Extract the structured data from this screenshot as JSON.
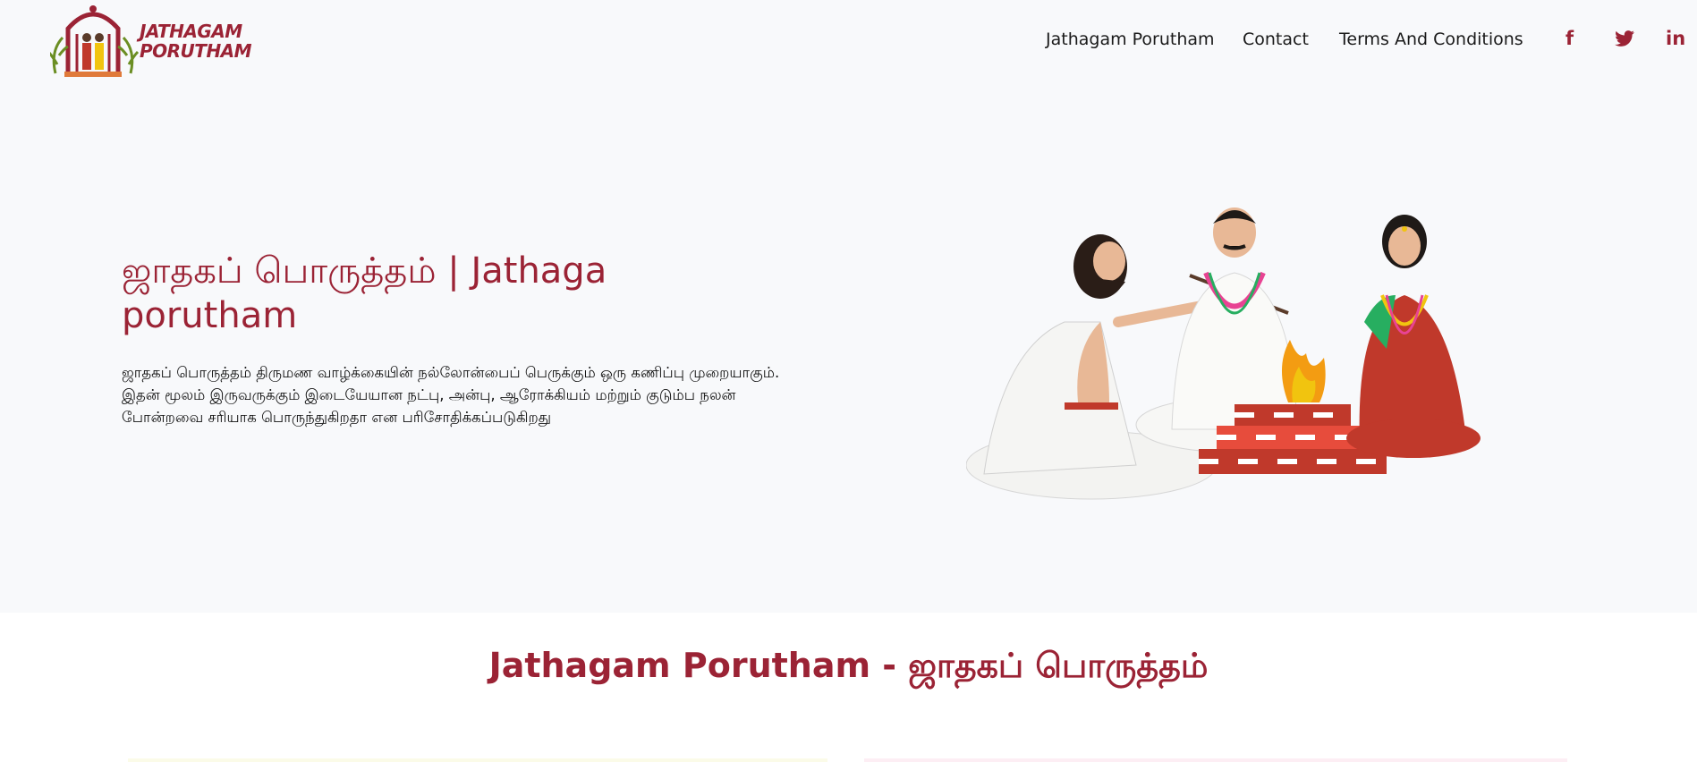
{
  "brand": {
    "logo_line1": "JATHAGAM",
    "logo_line2": "PORUTHAM",
    "brand_color": "#9b2335"
  },
  "nav": {
    "items": [
      {
        "label": "Jathagam Porutham"
      },
      {
        "label": "Contact"
      },
      {
        "label": "Terms And Conditions"
      }
    ]
  },
  "social": {
    "facebook": "f",
    "twitter": "twitter-icon",
    "linkedin": "in"
  },
  "hero": {
    "title": "ஜாதகப் பொருத்தம் | Jathaga porutham",
    "description": "ஜாதகப் பொருத்தம் திருமண வாழ்க்கையின் நல்லோன்பைப் பெருக்கும் ஒரு கணிப்பு முறையாகும். இதன் மூலம் இருவருக்கும் இடையேயான நட்பு, அன்பு, ஆரோக்கியம் மற்றும் குடும்ப நலன் போன்றவை சரியாக பொருந்துகிறதா என பரிசோதிக்கப்படுகிறது",
    "illustration": "wedding-homam-illustration"
  },
  "section": {
    "title": "Jathagam Porutham - ஜாதகப் பொருத்தம்"
  }
}
